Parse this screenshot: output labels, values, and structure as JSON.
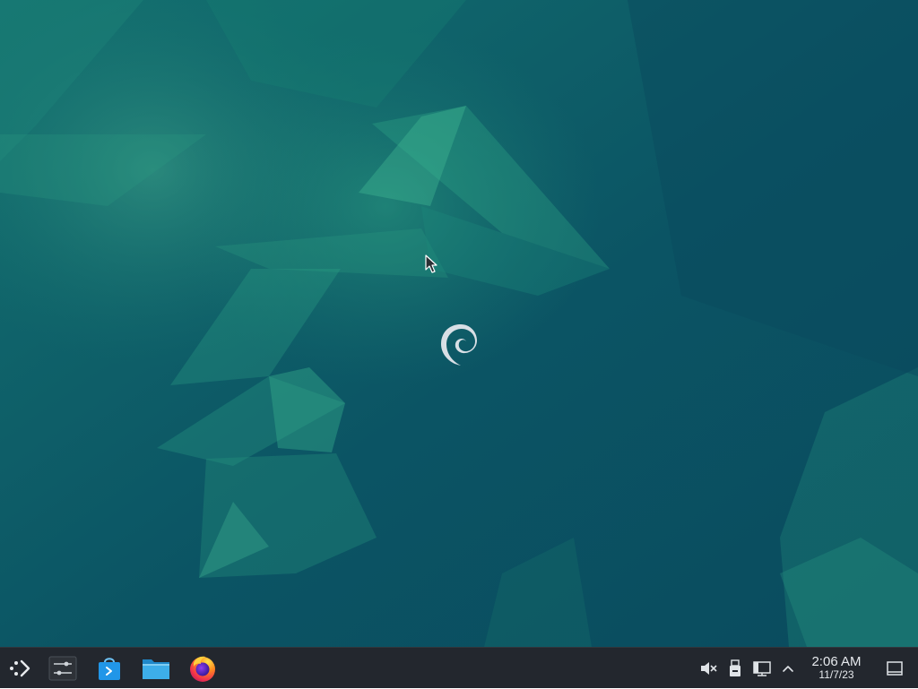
{
  "desktop": {
    "background_color": "#0c4f5f",
    "accent_color": "#2fa37f",
    "wallpaper_name": "debian-emerald-wallpaper"
  },
  "taskbar": {
    "background_color": "#23272e",
    "launcher": {
      "icon": "application-launcher-icon"
    },
    "tasks": [
      {
        "name": "system-settings",
        "icon": "settings-sliders-icon"
      },
      {
        "name": "discover",
        "icon": "discover-store-icon"
      },
      {
        "name": "dolphin-files",
        "icon": "folder-icon"
      },
      {
        "name": "firefox",
        "icon": "firefox-icon"
      }
    ],
    "tray": [
      {
        "name": "volume",
        "icon": "volume-muted-icon"
      },
      {
        "name": "removable-storage",
        "icon": "usb-drive-icon"
      },
      {
        "name": "network",
        "icon": "network-wired-icon"
      },
      {
        "name": "expand",
        "icon": "chevron-up-icon"
      }
    ],
    "clock": {
      "time": "2:06 AM",
      "date": "11/7/23"
    },
    "show_desktop": {
      "icon": "show-desktop-icon"
    }
  }
}
